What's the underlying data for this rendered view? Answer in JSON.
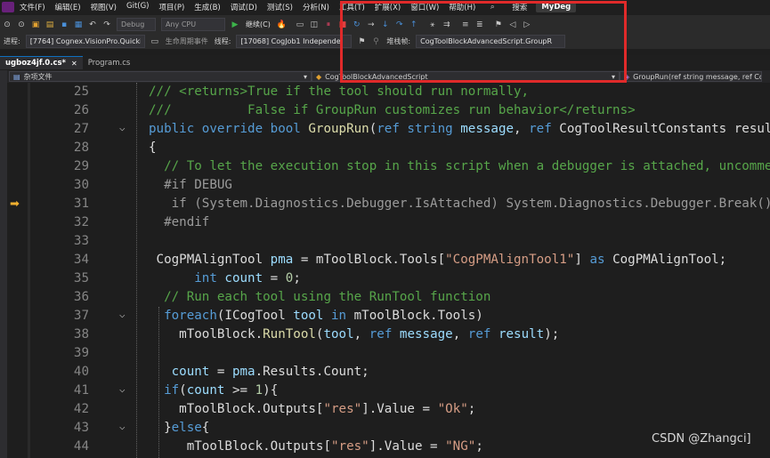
{
  "menu": {
    "items": [
      "文件(F)",
      "编辑(E)",
      "视图(V)",
      "Git(G)",
      "项目(P)",
      "生成(B)",
      "调试(D)",
      "测试(S)",
      "分析(N)",
      "工具(T)",
      "扩展(X)",
      "窗口(W)",
      "帮助(H)"
    ],
    "search_label": "搜索",
    "project_name": "MyDeg"
  },
  "toolbar": {
    "config": "Debug",
    "platform": "Any CPU",
    "start_label": "继续(C)"
  },
  "debug_toolbar": {
    "process_label": "进程:",
    "process_value": "[7764] Cognex.VisionPro.Quicki",
    "lifecycle_label": "生命周期事件",
    "thread_label": "线程:",
    "thread_value": "[17068] CogJob1 Independe",
    "stack_label": "堆栈帧:",
    "stack_value": "CogToolBlockAdvancedScript.GroupR"
  },
  "tabs": [
    {
      "label": "ugboz4jf.0.cs*",
      "active": true
    },
    {
      "label": "Program.cs",
      "active": false
    }
  ],
  "navbar": {
    "project": "杂项文件",
    "class": "CogToolBlockAdvancedScript",
    "member": "GroupRun(ref string message, ref Cog"
  },
  "code_lines": [
    {
      "n": "25",
      "fold": "",
      "tokens": [
        [
          "c-cm",
          "/// <returns>True if the tool should run normally,"
        ]
      ]
    },
    {
      "n": "26",
      "fold": "",
      "tokens": [
        [
          "c-cm",
          "///          False if GroupRun customizes run behavior</returns>"
        ]
      ]
    },
    {
      "n": "27",
      "fold": "⌵",
      "tokens": [
        [
          "c-kw",
          "public override bool "
        ],
        [
          "c-fn",
          "GroupRun"
        ],
        [
          "c-tx",
          "("
        ],
        [
          "c-kw",
          "ref string "
        ],
        [
          "c-va",
          "message"
        ],
        [
          "c-tx",
          ", "
        ],
        [
          "c-kw",
          "ref "
        ],
        [
          "c-tx",
          "CogToolResultConstants resul"
        ]
      ]
    },
    {
      "n": "28",
      "fold": "",
      "tokens": [
        [
          "c-tx",
          "{"
        ]
      ]
    },
    {
      "n": "29",
      "fold": "",
      "tokens": [
        [
          "c-cm",
          "  // To let the execution stop in this script when a debugger is attached, uncomme"
        ]
      ]
    },
    {
      "n": "30",
      "fold": "",
      "tokens": [
        [
          "c-pp",
          "  #if DEBUG"
        ]
      ]
    },
    {
      "n": "31",
      "fold": "",
      "tokens": [
        [
          "c-pp",
          "   if (System.Diagnostics.Debugger.IsAttached) System.Diagnostics.Debugger.Break()"
        ]
      ]
    },
    {
      "n": "32",
      "fold": "",
      "tokens": [
        [
          "c-pp",
          "  #endif"
        ]
      ]
    },
    {
      "n": "33",
      "fold": "",
      "tokens": [
        [
          "c-tx",
          ""
        ]
      ]
    },
    {
      "n": "34",
      "fold": "",
      "tokens": [
        [
          "c-tx",
          " CogPMAlignTool "
        ],
        [
          "c-va",
          "pma"
        ],
        [
          "c-tx",
          " = mToolBlock.Tools["
        ],
        [
          "c-st",
          "\"CogPMAlignTool1\""
        ],
        [
          "c-tx",
          "] "
        ],
        [
          "c-kw",
          "as"
        ],
        [
          "c-tx",
          " CogPMAlignTool;"
        ]
      ]
    },
    {
      "n": "35",
      "fold": "",
      "tokens": [
        [
          "c-kw",
          "      int "
        ],
        [
          "c-va",
          "count"
        ],
        [
          "c-tx",
          " = "
        ],
        [
          "c-nu",
          "0"
        ],
        [
          "c-tx",
          ";"
        ]
      ]
    },
    {
      "n": "36",
      "fold": "",
      "tokens": [
        [
          "c-cm",
          "  // Run each tool using the RunTool function"
        ]
      ]
    },
    {
      "n": "37",
      "fold": "⌵",
      "tokens": [
        [
          "c-kw",
          "  foreach"
        ],
        [
          "c-tx",
          "(ICogTool "
        ],
        [
          "c-va",
          "tool"
        ],
        [
          "c-kw",
          " in "
        ],
        [
          "c-tx",
          "mToolBlock.Tools)"
        ]
      ]
    },
    {
      "n": "38",
      "fold": "",
      "tokens": [
        [
          "c-tx",
          "    mToolBlock."
        ],
        [
          "c-fn",
          "RunTool"
        ],
        [
          "c-tx",
          "("
        ],
        [
          "c-va",
          "tool"
        ],
        [
          "c-tx",
          ", "
        ],
        [
          "c-kw",
          "ref "
        ],
        [
          "c-va",
          "message"
        ],
        [
          "c-tx",
          ", "
        ],
        [
          "c-kw",
          "ref "
        ],
        [
          "c-va",
          "result"
        ],
        [
          "c-tx",
          ");"
        ]
      ]
    },
    {
      "n": "39",
      "fold": "",
      "tokens": [
        [
          "c-tx",
          ""
        ]
      ]
    },
    {
      "n": "40",
      "fold": "",
      "tokens": [
        [
          "c-va",
          "   count"
        ],
        [
          "c-tx",
          " = "
        ],
        [
          "c-va",
          "pma"
        ],
        [
          "c-tx",
          ".Results.Count;"
        ]
      ]
    },
    {
      "n": "41",
      "fold": "⌵",
      "tokens": [
        [
          "c-kw",
          "  if"
        ],
        [
          "c-tx",
          "("
        ],
        [
          "c-va",
          "count"
        ],
        [
          "c-tx",
          " >= "
        ],
        [
          "c-nu",
          "1"
        ],
        [
          "c-tx",
          "){"
        ]
      ]
    },
    {
      "n": "42",
      "fold": "",
      "tokens": [
        [
          "c-tx",
          "    mToolBlock.Outputs["
        ],
        [
          "c-st",
          "\"res\""
        ],
        [
          "c-tx",
          "].Value = "
        ],
        [
          "c-st",
          "\"Ok\""
        ],
        [
          "c-tx",
          ";"
        ]
      ]
    },
    {
      "n": "43",
      "fold": "⌵",
      "tokens": [
        [
          "c-tx",
          "  }"
        ],
        [
          "c-kw",
          "else"
        ],
        [
          "c-tx",
          "{"
        ]
      ]
    },
    {
      "n": "44",
      "fold": "",
      "tokens": [
        [
          "c-tx",
          "     mToolBlock.Outputs["
        ],
        [
          "c-st",
          "\"res\""
        ],
        [
          "c-tx",
          "].Value = "
        ],
        [
          "c-st",
          "\"NG\""
        ],
        [
          "c-tx",
          ";"
        ]
      ]
    }
  ],
  "watermark": "CSDN @Zhangci]",
  "colors": {
    "highlight_box": "#e02a2a",
    "comment": "#57a64a",
    "keyword": "#569cd6",
    "string": "#d69d85"
  }
}
